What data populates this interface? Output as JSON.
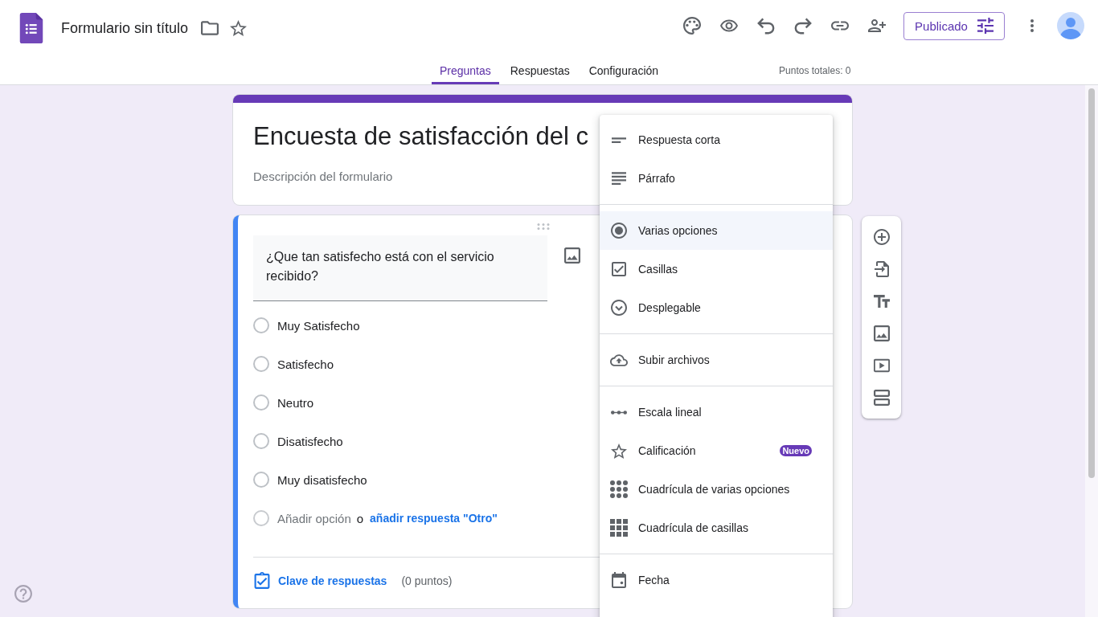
{
  "header": {
    "title": "Formulario sin título",
    "publish_button": "Publicado"
  },
  "tabs": [
    {
      "label": "Preguntas",
      "selected": true
    },
    {
      "label": "Respuestas",
      "selected": false
    },
    {
      "label": "Configuración",
      "selected": false
    }
  ],
  "total_points": "Puntos totales: 0",
  "form_header": {
    "title": "Encuesta de satisfacción del c",
    "placeholder": "Descripción del formulario"
  },
  "question": {
    "active": true,
    "title": "¿Que tan satisfecho está con el servicio recibido?",
    "options": [
      {
        "label": "Muy Satisfecho"
      },
      {
        "label": "Satisfecho"
      },
      {
        "label": "Neutro"
      },
      {
        "label": "Disatisfecho"
      },
      {
        "label": "Muy disatisfecho"
      }
    ],
    "add_option": {
      "label": "Añadir opción",
      "joiner": "o",
      "other_link": "añadir respuesta \"Otro\""
    },
    "answer_key": {
      "label": "Clave de respuestas",
      "points": "(0 puntos)"
    }
  },
  "type_menu": {
    "groups": [
      {
        "items": [
          {
            "kind": "short",
            "label": "Respuesta corta",
            "selected": false
          },
          {
            "kind": "paragraph",
            "label": "Párrafo",
            "selected": false
          }
        ]
      },
      {
        "items": [
          {
            "kind": "radio",
            "label": "Varias opciones",
            "selected": true
          },
          {
            "kind": "checkbox",
            "label": "Casillas",
            "selected": false
          },
          {
            "kind": "dropdown",
            "label": "Desplegable",
            "selected": false
          }
        ]
      },
      {
        "items": [
          {
            "kind": "upload",
            "label": "Subir archivos",
            "selected": false
          }
        ]
      },
      {
        "items": [
          {
            "kind": "scale",
            "label": "Escala lineal",
            "selected": false
          },
          {
            "kind": "rating",
            "label": "Calificación",
            "selected": false,
            "badge": "Nuevo"
          },
          {
            "kind": "radiogrid",
            "label": "Cuadrícula de varias opciones",
            "selected": false
          },
          {
            "kind": "checkgrid",
            "label": "Cuadrícula de casillas",
            "selected": false
          }
        ]
      },
      {
        "items": [
          {
            "kind": "date",
            "label": "Fecha",
            "selected": false
          }
        ]
      }
    ]
  }
}
